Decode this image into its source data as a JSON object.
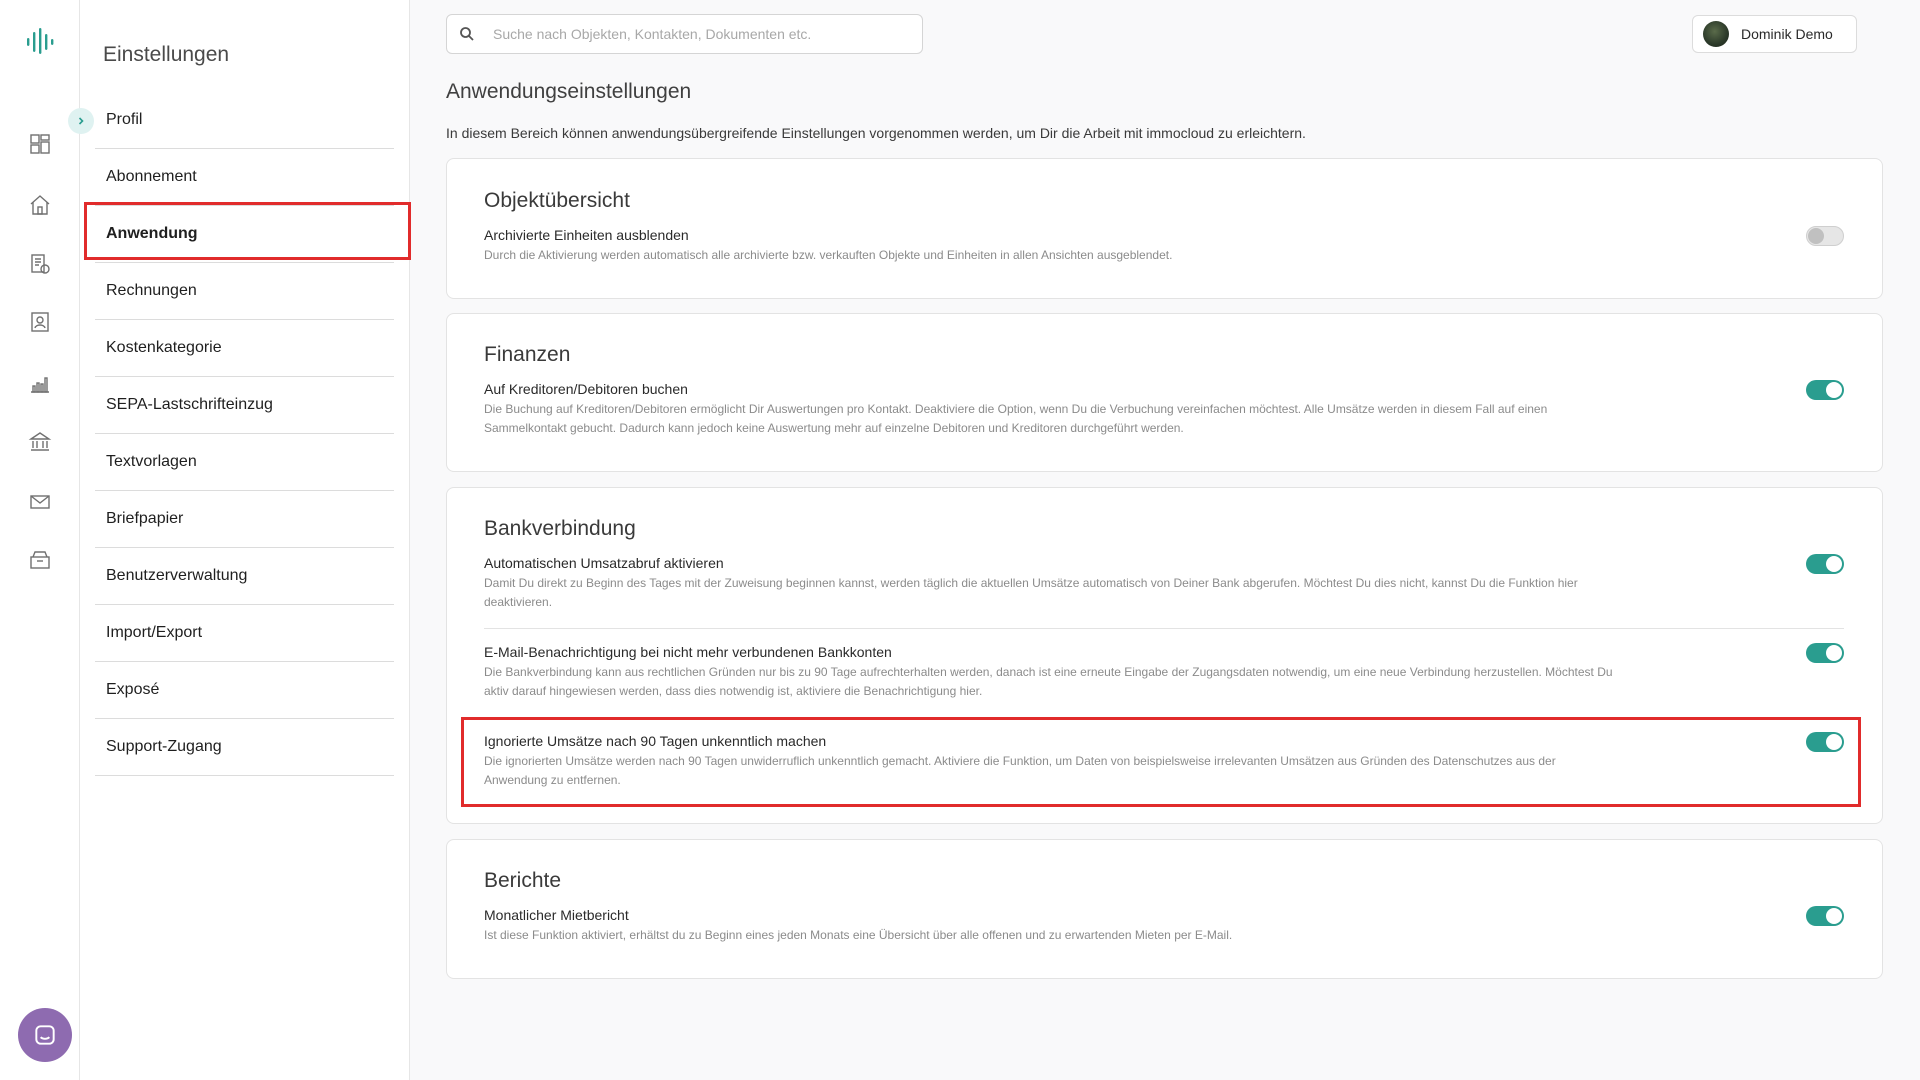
{
  "settings": {
    "title": "Einstellungen",
    "menu": [
      "Profil",
      "Abonnement",
      "Anwendung",
      "Rechnungen",
      "Kostenkategorie",
      "SEPA-Lastschrifteinzug",
      "Textvorlagen",
      "Briefpapier",
      "Benutzerverwaltung",
      "Import/Export",
      "Exposé",
      "Support-Zugang"
    ],
    "active": "Anwendung"
  },
  "rail": {
    "icons": [
      "dashboard-icon",
      "home-icon",
      "finance-icon",
      "contacts-icon",
      "chart-icon",
      "bank-icon",
      "mail-icon",
      "archive-icon"
    ]
  },
  "search": {
    "placeholder": "Suche nach Objekten, Kontakten, Dokumenten etc."
  },
  "user": {
    "name": "Dominik Demo"
  },
  "page": {
    "title": "Anwendungseinstellungen",
    "intro": "In diesem Bereich können anwendungsübergreifende Einstellungen vorgenommen werden, um Dir die Arbeit mit immocloud zu erleichtern."
  },
  "sections": [
    {
      "title": "Objektübersicht",
      "settings": [
        {
          "title": "Archivierte Einheiten ausblenden",
          "description": "Durch die Aktivierung werden automatisch alle archivierte bzw. verkauften Objekte und Einheiten in allen Ansichten ausgeblendet.",
          "enabled": false
        }
      ]
    },
    {
      "title": "Finanzen",
      "settings": [
        {
          "title": "Auf Kreditoren/Debitoren buchen",
          "description": "Die Buchung auf Kreditoren/Debitoren ermöglicht Dir Auswertungen pro Kontakt. Deaktiviere die Option, wenn Du die Verbuchung vereinfachen möchtest. Alle Umsätze werden in diesem Fall auf einen Sammelkontakt gebucht. Dadurch kann jedoch keine Auswertung mehr auf einzelne Debitoren und Kreditoren durchgeführt werden.",
          "enabled": true
        }
      ]
    },
    {
      "title": "Bankverbindung",
      "settings": [
        {
          "title": "Automatischen Umsatzabruf aktivieren",
          "description": "Damit Du direkt zu Beginn des Tages mit der Zuweisung beginnen kannst, werden täglich die aktuellen Umsätze automatisch von Deiner Bank abgerufen. Möchtest Du dies nicht, kannst Du die Funktion hier deaktivieren.",
          "enabled": true
        },
        {
          "title": "E-Mail-Benachrichtigung bei nicht mehr verbundenen Bankkonten",
          "description": "Die Bankverbindung kann aus rechtlichen Gründen nur bis zu 90 Tage aufrechterhalten werden, danach ist eine erneute Eingabe der Zugangsdaten notwendig, um eine neue Verbindung herzustellen. Möchtest Du aktiv darauf hingewiesen werden, dass dies notwendig ist, aktiviere die Benachrichtigung hier.",
          "enabled": true
        },
        {
          "title": "Ignorierte Umsätze nach 90 Tagen unkenntlich machen",
          "description": "Die ignorierten Umsätze werden nach 90 Tagen unwiderruflich unkenntlich gemacht. Aktiviere die Funktion, um Daten von beispielsweise irrelevanten Umsätzen aus Gründen des Datenschutzes aus der Anwendung zu entfernen.",
          "enabled": true
        }
      ]
    },
    {
      "title": "Berichte",
      "settings": [
        {
          "title": "Monatlicher Mietbericht",
          "description": "Ist diese Funktion aktiviert, erhältst du zu Beginn eines jeden Monats eine Übersicht über alle offenen und zu erwartenden Mieten per E-Mail.",
          "enabled": true
        }
      ]
    }
  ],
  "colors": {
    "accent": "#2a9d8f",
    "highlight": "#e12b2b",
    "chat": "#8e6bb0"
  }
}
